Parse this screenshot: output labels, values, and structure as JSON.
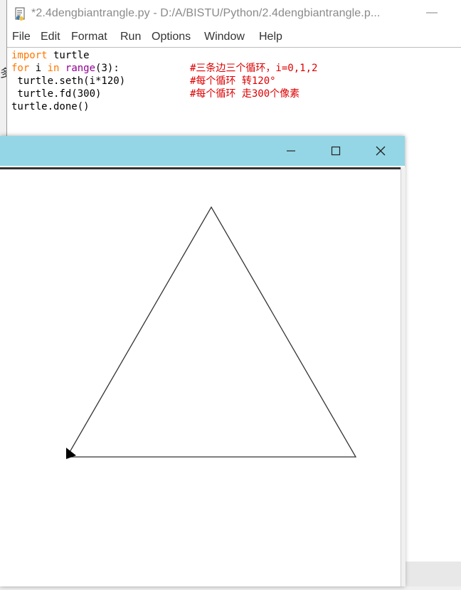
{
  "editor": {
    "title": "*2.4dengbiantrangle.py - D:/A/BISTU/Python/2.4dengbiantrangle.p...",
    "minimize_glyph": "—",
    "menu": [
      "File",
      "Edit",
      "Format",
      "Run",
      "Options",
      "Window",
      "Help"
    ],
    "left_edge_glyph": "多",
    "code": {
      "line1": {
        "kw": "import",
        "rest": " turtle"
      },
      "line2": {
        "kw1": "for",
        "mid1": " i ",
        "kw2": "in",
        "mid2": " ",
        "bi": "range",
        "rest": "(3):"
      },
      "line3": " turtle.seth(i*120)",
      "line4": " turtle.fd(300)",
      "line5": "turtle.done()",
      "comment2": "#三条边三个循环，i=0,1,2",
      "comment3": "#每个循环 转120°",
      "comment4": "#每个循环 走300个像素"
    }
  },
  "turtle_window": {
    "titlebar_color": "#94d6e6",
    "icons": [
      "minimize-icon",
      "maximize-icon",
      "close-icon"
    ]
  },
  "colors": {
    "keyword": "#ff7700",
    "builtin": "#900090",
    "comment": "#dd0000"
  }
}
